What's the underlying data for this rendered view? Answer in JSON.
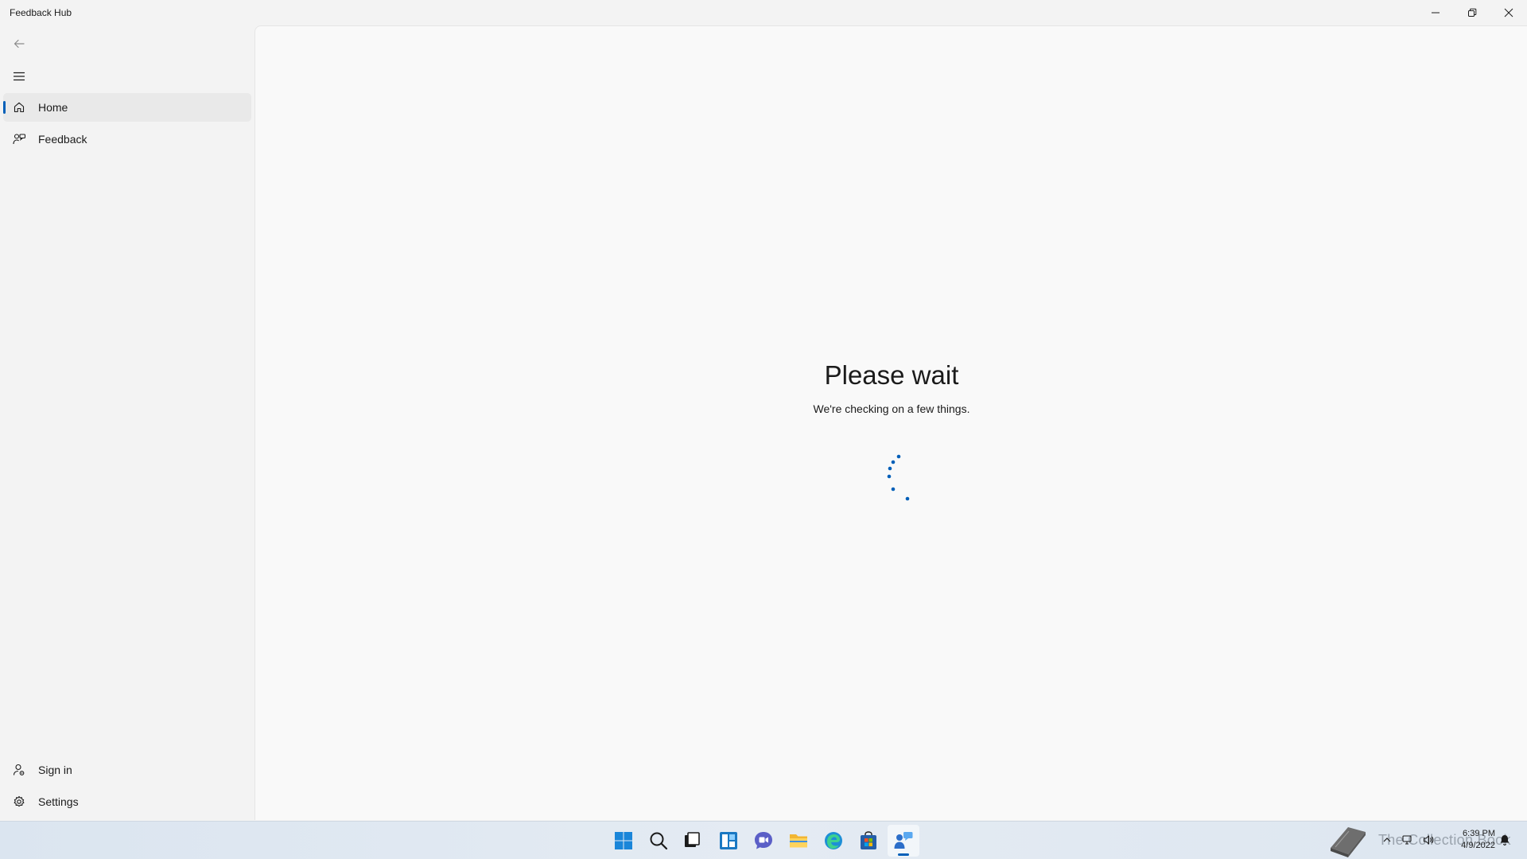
{
  "window": {
    "title": "Feedback Hub"
  },
  "sidebar": {
    "items": [
      {
        "label": "Home",
        "icon": "home-icon",
        "selected": true
      },
      {
        "label": "Feedback",
        "icon": "feedback-icon",
        "selected": false
      }
    ],
    "footer_items": [
      {
        "label": "Sign in",
        "icon": "sign-in-icon"
      },
      {
        "label": "Settings",
        "icon": "gear-icon"
      }
    ]
  },
  "main": {
    "heading": "Please wait",
    "message": "We're checking on a few things."
  },
  "taskbar": {
    "apps": [
      {
        "name": "start",
        "icon": "windows-start-icon"
      },
      {
        "name": "search",
        "icon": "search-icon"
      },
      {
        "name": "task-view",
        "icon": "task-view-icon"
      },
      {
        "name": "widgets",
        "icon": "widgets-icon"
      },
      {
        "name": "chat",
        "icon": "chat-icon"
      },
      {
        "name": "file-explorer",
        "icon": "folder-icon"
      },
      {
        "name": "edge",
        "icon": "edge-browser-icon"
      },
      {
        "name": "store",
        "icon": "store-icon"
      },
      {
        "name": "feedback-hub",
        "icon": "feedback-hub-icon",
        "active": true
      }
    ],
    "tray_watermark": "The Collection Book",
    "clock_time": "6:39 PM",
    "clock_date": "4/9/2022"
  },
  "colors": {
    "accent": "#005fb8",
    "window_bg": "#f3f3f3",
    "content_bg": "#f9f9f9"
  }
}
